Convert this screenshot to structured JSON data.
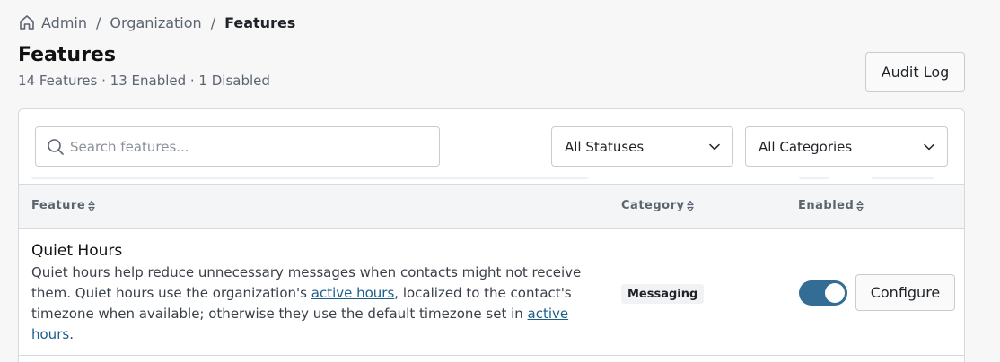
{
  "breadcrumb": {
    "items": [
      "Admin",
      "Organization"
    ],
    "separator": "/",
    "current": "Features"
  },
  "page": {
    "title": "Features",
    "subtitle": "14 Features · 13 Enabled · 1 Disabled"
  },
  "toolbar": {
    "audit_log_label": "Audit Log"
  },
  "filters": {
    "search_placeholder": "Search features...",
    "status_selected": "All Statuses",
    "category_selected": "All Categories"
  },
  "table": {
    "columns": [
      "Feature",
      "Category",
      "Enabled"
    ],
    "rows": [
      {
        "name": "Quiet Hours",
        "desc_1": "Quiet hours help reduce unnecessary messages when contacts might not receive them. Quiet hours use the organization's ",
        "link_1": "active hours",
        "desc_2": ", localized to the contact's timezone when available; otherwise they use the default timezone set in ",
        "link_2": "active hours",
        "desc_3": ".",
        "category": "Messaging",
        "enabled": true,
        "configure_label": "Configure"
      }
    ]
  },
  "icons": {
    "breadcrumb_home": "home-icon",
    "search": "search-icon",
    "select_chevron": "chevron-down-icon",
    "column_sort": "sort-icon"
  },
  "colors": {
    "accent": "#336c94",
    "link": "#1d5e8a"
  }
}
